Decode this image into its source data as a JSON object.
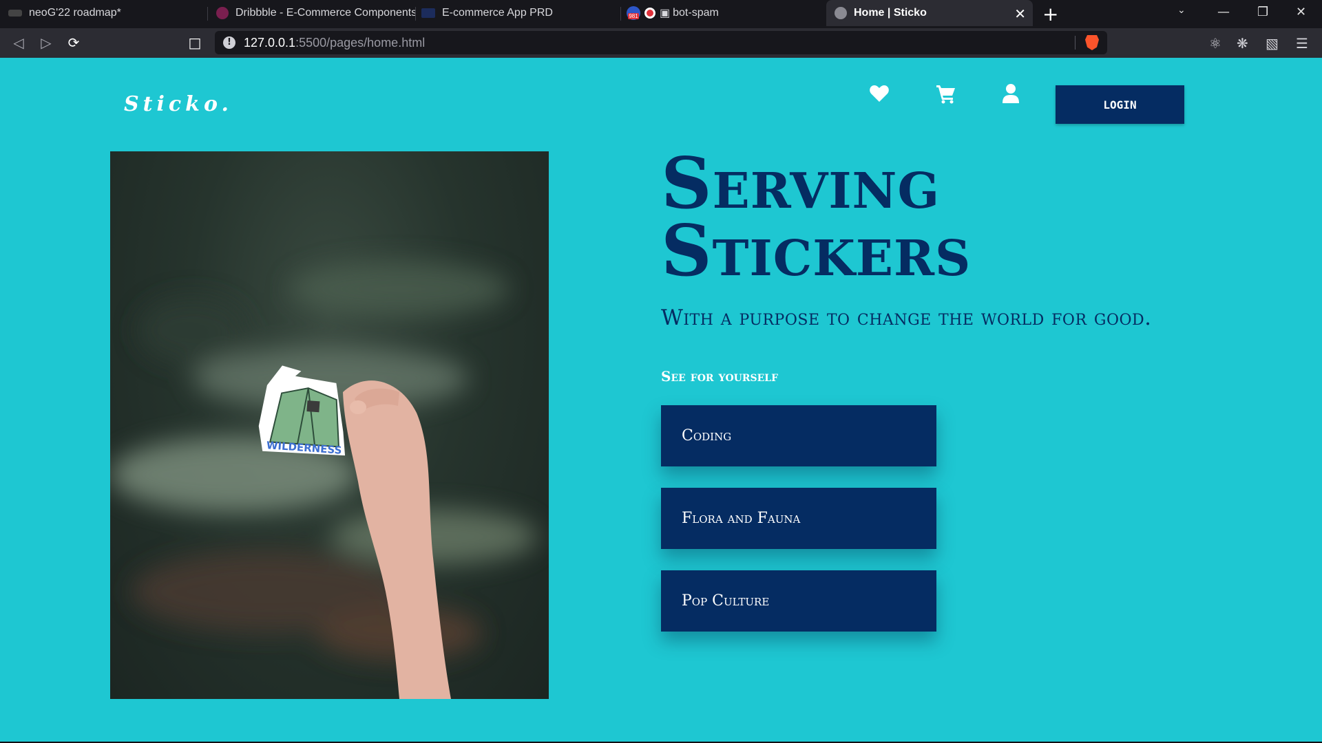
{
  "browser": {
    "tabs": [
      {
        "title": "neoG'22 roadmap*",
        "active": false
      },
      {
        "title": "Dribbble - E-Commerce Components",
        "active": false
      },
      {
        "title": "E-commerce App PRD",
        "active": false
      },
      {
        "title": "bot-spam",
        "active": false,
        "badge": "981"
      },
      {
        "title": "Home | Sticko",
        "active": true
      }
    ],
    "url_host": "127.0.0.1",
    "url_path": ":5500/pages/home.html"
  },
  "header": {
    "logo": "Sticko.",
    "login_label": "LOGIN",
    "icons": [
      "heart-icon",
      "cart-icon",
      "user-icon"
    ]
  },
  "hero": {
    "title_line1": "Serving",
    "title_line2": "Stickers",
    "subtitle": "With a purpose to change the world for good.",
    "see_label": "See for yourself",
    "sticker_text": "WILDERNESS"
  },
  "categories": [
    {
      "label": "Coding"
    },
    {
      "label": "Flora and Fauna"
    },
    {
      "label": "Pop Culture"
    }
  ],
  "colors": {
    "background": "#1ec7d2",
    "primary": "#052c62",
    "text_light": "#ffffff",
    "chrome_dark": "#17171c",
    "chrome_mid": "#2c2c33"
  }
}
